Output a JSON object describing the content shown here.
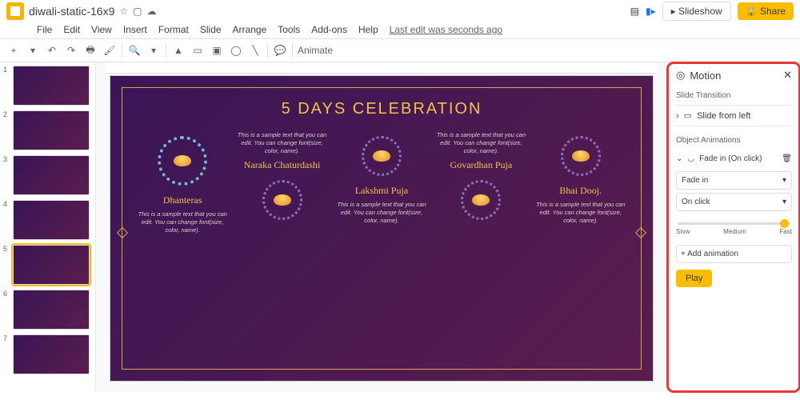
{
  "header": {
    "doc_title": "diwali-static-16x9",
    "slideshow": "Slideshow",
    "share": "Share",
    "last_edit": "Last edit was seconds ago"
  },
  "menus": [
    "File",
    "Edit",
    "View",
    "Insert",
    "Format",
    "Slide",
    "Arrange",
    "Tools",
    "Add-ons",
    "Help"
  ],
  "toolbar": {
    "animate": "Animate"
  },
  "thumbs": [
    1,
    2,
    3,
    4,
    5,
    6,
    7
  ],
  "selected_thumb": 5,
  "slide": {
    "title": "5 DAYS CELEBRATION",
    "sample": "This is a sample text that you can edit. You can change font(size, color, name).",
    "days": [
      {
        "name": "Dhanteras",
        "pos": "down",
        "big": true
      },
      {
        "name": "Naraka Chaturdashi",
        "pos": "up"
      },
      {
        "name": "Lakshmi Puja",
        "pos": "down"
      },
      {
        "name": "Govardhan Puja",
        "pos": "up"
      },
      {
        "name": "Bhai Dooj.",
        "pos": "down"
      }
    ]
  },
  "motion": {
    "title": "Motion",
    "slide_transition_label": "Slide Transition",
    "transition": "Slide from left",
    "object_anim_label": "Object Animations",
    "anim_item": "Fade in  (On click)",
    "effect": "Fade in",
    "trigger": "On click",
    "speed": {
      "slow": "Slow",
      "medium": "Medium",
      "fast": "Fast"
    },
    "add_anim": "Add animation",
    "play": "Play"
  }
}
